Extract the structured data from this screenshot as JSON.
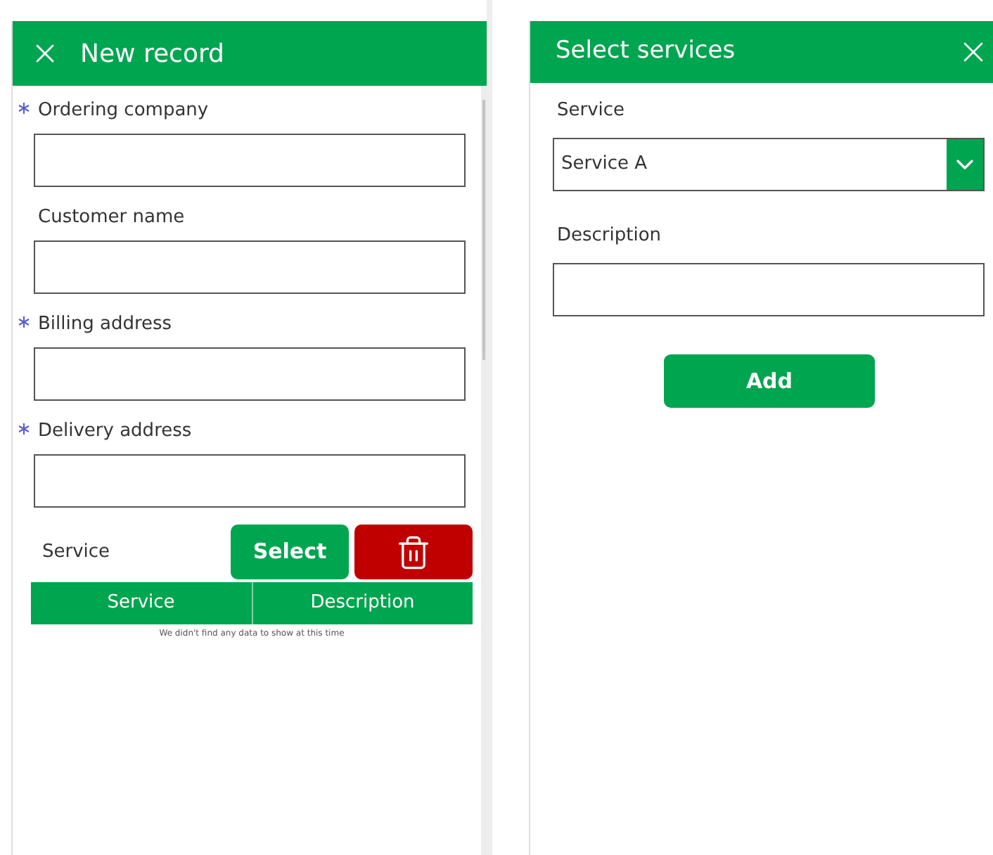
{
  "record_form": {
    "title": "New record",
    "fields": [
      {
        "label": "Ordering company",
        "required": true
      },
      {
        "label": "Customer name",
        "required": false
      },
      {
        "label": "Billing address",
        "required": true
      },
      {
        "label": "Delivery address",
        "required": true
      }
    ],
    "service_label": "Service",
    "select_button": "Select",
    "table": {
      "columns": [
        "Service",
        "Description"
      ],
      "empty_message": "We didn't find any data to show at this time"
    }
  },
  "services_dialog": {
    "title": "Select services",
    "service_label": "Service",
    "service_value": "Service A",
    "description_label": "Description",
    "add_button": "Add"
  }
}
